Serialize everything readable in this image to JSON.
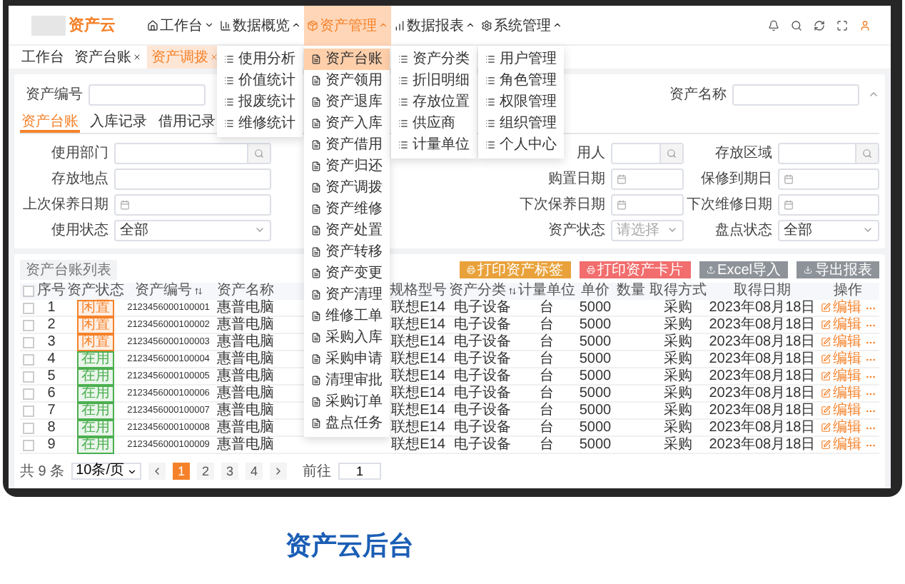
{
  "logo": "资产云",
  "nav": [
    {
      "label": "工作台",
      "selected": false,
      "expanded": false
    },
    {
      "label": "数据概览",
      "selected": false,
      "expanded": true,
      "menu": [
        "使用分析",
        "价值统计",
        "报废统计",
        "维修统计"
      ]
    },
    {
      "label": "资产管理",
      "selected": true,
      "expanded": true,
      "menu": [
        {
          "label": "资产台账",
          "selected": true
        },
        {
          "label": "资产领用",
          "selected": false
        },
        {
          "label": "资产退库",
          "selected": false
        },
        {
          "label": "资产入库",
          "selected": false
        },
        {
          "label": "资产借用",
          "selected": false
        },
        {
          "label": "资产归还",
          "selected": false
        },
        {
          "label": "资产调拨",
          "selected": false
        },
        {
          "label": "资产维修",
          "selected": false
        },
        {
          "label": "资产处置",
          "selected": false
        },
        {
          "label": "资产转移",
          "selected": false
        },
        {
          "label": "资产变更",
          "selected": false
        },
        {
          "label": "资产清理",
          "selected": false
        },
        {
          "label": "维修工单",
          "selected": false
        },
        {
          "label": "采购入库",
          "selected": false
        },
        {
          "label": "采购申请",
          "selected": false
        },
        {
          "label": "清理审批",
          "selected": false
        },
        {
          "label": "采购订单",
          "selected": false
        },
        {
          "label": "盘点任务",
          "selected": false
        }
      ]
    },
    {
      "label": "数据报表",
      "selected": false,
      "expanded": true,
      "menu": [
        "资产分类",
        "折旧明细",
        "存放位置",
        "供应商",
        "计量单位"
      ]
    },
    {
      "label": "系统管理",
      "selected": false,
      "expanded": true,
      "menu": [
        "用户管理",
        "角色管理",
        "权限管理",
        "组织管理",
        "个人中心"
      ]
    }
  ],
  "tabs": [
    {
      "label": "工作台",
      "closable": false,
      "selected": false
    },
    {
      "label": "资产台账",
      "closable": true,
      "selected": false
    },
    {
      "label": "资产调拨",
      "closable": true,
      "selected": true
    }
  ],
  "search": [
    {
      "label": "资产编号"
    },
    {
      "label": "资产名称"
    }
  ],
  "subtabs": [
    {
      "label": "资产台账",
      "selected": true
    },
    {
      "label": "入库记录",
      "selected": false
    },
    {
      "label": "借用记录",
      "selected": false
    }
  ],
  "filters": [
    [
      {
        "label": "使用部门",
        "kind": "search"
      },
      {
        "label": "用人",
        "kind": "search"
      },
      {
        "label": "存放区域",
        "kind": "search"
      }
    ],
    [
      {
        "label": "存放地点",
        "kind": "input"
      },
      {
        "label": "购置日期",
        "kind": "date"
      },
      {
        "label": "保修到期日",
        "kind": "date"
      }
    ],
    [
      {
        "label": "上次保养日期",
        "kind": "date"
      },
      {
        "label": "下次保养日期",
        "kind": "date"
      },
      {
        "label": "下次维修日期",
        "kind": "date"
      }
    ],
    [
      {
        "label": "使用状态",
        "kind": "select",
        "value": "全部"
      },
      {
        "label": "资产状态",
        "kind": "select",
        "placeholder": "请选择"
      },
      {
        "label": "盘点状态",
        "kind": "select",
        "value": "全部"
      }
    ]
  ],
  "table": {
    "title": "资产台账列表",
    "buttons": [
      {
        "label": "打印资产标签",
        "color": "#e9a23b"
      },
      {
        "label": "打印资产卡片",
        "color": "#f26d6d"
      },
      {
        "label": "Excel导入",
        "color": "#8e9399"
      },
      {
        "label": "导出报表",
        "color": "#8e9399"
      }
    ],
    "all_checked": false,
    "columns": [
      {
        "label": "序号",
        "sortable": false
      },
      {
        "label": "资产状态",
        "sortable": false
      },
      {
        "label": "资产编号",
        "sortable": true
      },
      {
        "label": "资产名称",
        "sortable": false
      },
      {
        "label": "规格型号",
        "sortable": false
      },
      {
        "label": "资产分类",
        "sortable": true
      },
      {
        "label": "计量单位",
        "sortable": false
      },
      {
        "label": "单价",
        "sortable": false
      },
      {
        "label": "数量",
        "sortable": false
      },
      {
        "label": "取得方式",
        "sortable": false
      },
      {
        "label": "取得日期",
        "sortable": false
      },
      {
        "label": "操作",
        "sortable": false
      }
    ],
    "rows": [
      {
        "checked": false,
        "index": "1",
        "status": {
          "text": "闲置",
          "color": "#f5822a"
        },
        "code": "2123456000100001",
        "name": "惠普电脑",
        "model": "联想E14",
        "category": "电子设备",
        "unit": "台",
        "price": "5000",
        "method": "采购",
        "date": "2023年08月18日",
        "action": "编辑"
      },
      {
        "checked": false,
        "index": "2",
        "status": {
          "text": "闲置",
          "color": "#f5822a"
        },
        "code": "2123456000100002",
        "name": "惠普电脑",
        "model": "联想E14",
        "category": "电子设备",
        "unit": "台",
        "price": "5000",
        "method": "采购",
        "date": "2023年08月18日",
        "action": "编辑"
      },
      {
        "checked": false,
        "index": "3",
        "status": {
          "text": "闲置",
          "color": "#f5822a"
        },
        "code": "2123456000100003",
        "name": "惠普电脑",
        "model": "联想E14",
        "category": "电子设备",
        "unit": "台",
        "price": "5000",
        "method": "采购",
        "date": "2023年08月18日",
        "action": "编辑"
      },
      {
        "checked": false,
        "index": "4",
        "status": {
          "text": "在用",
          "color": "#4caf50"
        },
        "code": "2123456000100004",
        "name": "惠普电脑",
        "model": "联想E14",
        "category": "电子设备",
        "unit": "台",
        "price": "5000",
        "method": "采购",
        "date": "2023年08月18日",
        "action": "编辑"
      },
      {
        "checked": false,
        "index": "5",
        "status": {
          "text": "在用",
          "color": "#4caf50"
        },
        "code": "2123456000100005",
        "name": "惠普电脑",
        "model": "联想E14",
        "category": "电子设备",
        "unit": "台",
        "price": "5000",
        "method": "采购",
        "date": "2023年08月18日",
        "action": "编辑"
      },
      {
        "checked": false,
        "index": "6",
        "status": {
          "text": "在用",
          "color": "#4caf50"
        },
        "code": "2123456000100006",
        "name": "惠普电脑",
        "model": "联想E14",
        "category": "电子设备",
        "unit": "台",
        "price": "5000",
        "method": "采购",
        "date": "2023年08月18日",
        "action": "编辑"
      },
      {
        "checked": false,
        "index": "7",
        "status": {
          "text": "在用",
          "color": "#4caf50"
        },
        "code": "2123456000100007",
        "name": "惠普电脑",
        "model": "联想E14",
        "category": "电子设备",
        "unit": "台",
        "price": "5000",
        "method": "采购",
        "date": "2023年08月18日",
        "action": "编辑"
      },
      {
        "checked": false,
        "index": "8",
        "status": {
          "text": "在用",
          "color": "#4caf50"
        },
        "code": "2123456000100008",
        "name": "惠普电脑",
        "model": "联想E14",
        "category": "电子设备",
        "unit": "台",
        "price": "5000",
        "method": "采购",
        "date": "2023年08月18日",
        "action": "编辑"
      },
      {
        "checked": false,
        "index": "9",
        "status": {
          "text": "在用",
          "color": "#4caf50"
        },
        "code": "2123456000100009",
        "name": "惠普电脑",
        "model": "联想E14",
        "category": "电子设备",
        "unit": "台",
        "price": "5000",
        "method": "采购",
        "date": "2023年08月18日",
        "action": "编辑"
      }
    ]
  },
  "pagination": {
    "total": "共 9 条",
    "page_size": "10条/页",
    "pages": [
      {
        "label": "1",
        "selected": true
      },
      {
        "label": "2",
        "selected": false
      },
      {
        "label": "3",
        "selected": false
      },
      {
        "label": "4",
        "selected": false
      }
    ],
    "jump_label": "前往",
    "jump_value": "1"
  },
  "caption": "资产云后台"
}
